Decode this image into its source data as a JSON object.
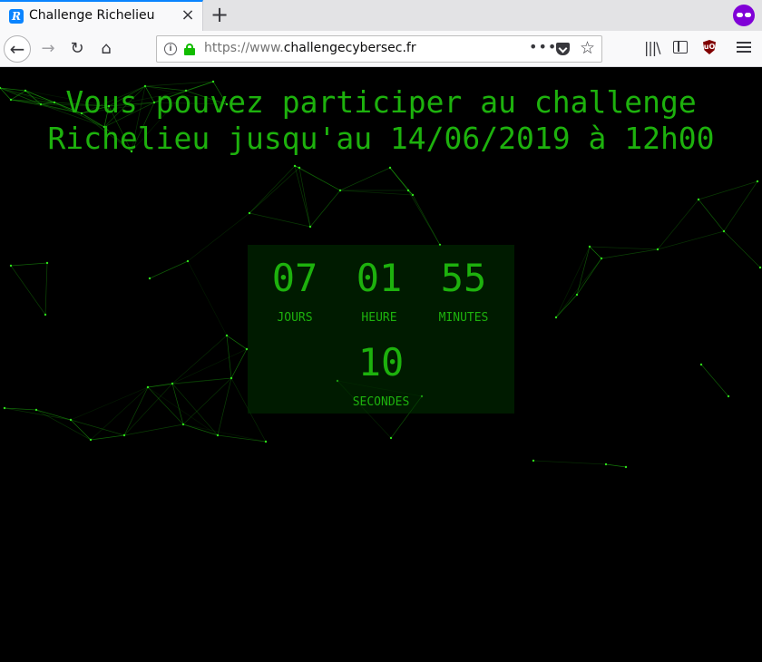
{
  "browser": {
    "tab": {
      "title": "Challenge Richelieu",
      "favicon_letter": "R",
      "close_glyph": "×"
    },
    "new_tab_glyph": "+",
    "nav": {
      "back_glyph": "←",
      "forward_glyph": "→",
      "reload_glyph": "↻",
      "home_glyph": "⌂"
    },
    "url": {
      "scheme": "https://www.",
      "host": "challengecybersec.fr"
    },
    "url_actions_glyph": "•••",
    "star_glyph": "☆",
    "library_glyph": "|||\\",
    "ublock_label": "uO",
    "accent_color": "#0a84ff",
    "private_color": "#8000d7"
  },
  "page": {
    "headline_line1": "Vous pouvez participer au challenge",
    "headline_line2": "Richelieu jusqu'au 14/06/2019 à 12h00",
    "text_color": "#1db10d",
    "background_color": "#000000",
    "countdown": {
      "days": {
        "value": "07",
        "label": "JOURS"
      },
      "hours": {
        "value": "01",
        "label": "HEURE"
      },
      "minutes": {
        "value": "55",
        "label": "MINUTES"
      },
      "seconds": {
        "value": "10",
        "label": "SECONDES"
      }
    }
  }
}
